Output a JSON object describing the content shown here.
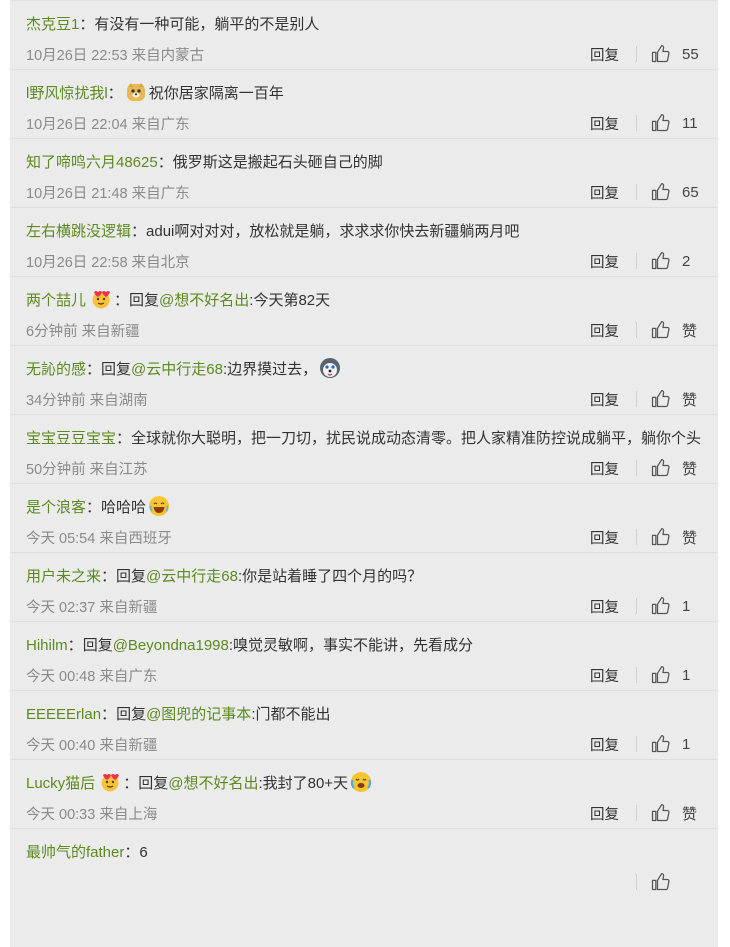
{
  "comments": [
    {
      "user": "杰克豆1",
      "sep": "：",
      "reply_prefix": "",
      "mention": "",
      "text": "有没有一种可能，躺平的不是别人",
      "emoji_before": "",
      "emoji_after": "",
      "time": "10月26日 22:53",
      "loc": "来自内蒙古",
      "reply": "回复",
      "likes": "55"
    },
    {
      "user": "l野风惊扰我l",
      "sep": "：",
      "reply_prefix": "",
      "mention": "",
      "text": "祝你居家隔离一百年",
      "emoji_before": "doge-emoji",
      "emoji_after": "",
      "time": "10月26日 22:04",
      "loc": "来自广东",
      "reply": "回复",
      "likes": "11"
    },
    {
      "user": "知了啼鸣六月48625",
      "sep": "：",
      "reply_prefix": "",
      "mention": "",
      "text": "俄罗斯这是搬起石头砸自己的脚",
      "emoji_before": "",
      "emoji_after": "",
      "time": "10月26日 21:48",
      "loc": "来自广东",
      "reply": "回复",
      "likes": "65"
    },
    {
      "user": "左右横跳没逻辑",
      "sep": "：",
      "reply_prefix": "",
      "mention": "",
      "text": "adui啊对对对，放松就是躺，求求求你快去新疆躺两月吧",
      "emoji_before": "",
      "emoji_after": "",
      "time": "10月26日 22:58",
      "loc": "来自北京",
      "reply": "回复",
      "likes": "2"
    },
    {
      "user": "两个喆儿",
      "sep": "：",
      "reply_prefix": "回复",
      "mention": "@想不好名出",
      "text": ":今天第82天",
      "emoji_before": "",
      "emoji_after": "",
      "user_badge": "heart-badge-emoji",
      "time": "6分钟前",
      "loc": "来自新疆",
      "reply": "回复",
      "likes": "赞"
    },
    {
      "user": "无訫的感",
      "sep": "：",
      "reply_prefix": "回复",
      "mention": "@云中行走68",
      "text": ":边界摸过去，",
      "emoji_before": "",
      "emoji_after": "husky-emoji",
      "time": "34分钟前",
      "loc": "来自湖南",
      "reply": "回复",
      "likes": "赞"
    },
    {
      "user": "宝宝豆豆宝宝",
      "sep": "：",
      "reply_prefix": "",
      "mention": "",
      "text": "全球就你大聪明，把一刀切，扰民说成动态清零。把人家精准防控说成躺平，躺你个头",
      "emoji_before": "",
      "emoji_after": "",
      "time": "50分钟前",
      "loc": "来自江苏",
      "reply": "回复",
      "likes": "赞"
    },
    {
      "user": "是个浪客",
      "sep": "：",
      "reply_prefix": "",
      "mention": "",
      "text": "哈哈哈",
      "emoji_before": "",
      "emoji_after": "laugh-emoji",
      "time": "今天 05:54",
      "loc": "来自西班牙",
      "reply": "回复",
      "likes": "赞"
    },
    {
      "user": "用户未之来",
      "sep": "：",
      "reply_prefix": "回复",
      "mention": "@云中行走68",
      "text": ":你是站着睡了四个月的吗？",
      "emoji_before": "",
      "emoji_after": "",
      "time": "今天 02:37",
      "loc": "来自新疆",
      "reply": "回复",
      "likes": "1"
    },
    {
      "user": "Hihilm",
      "sep": "：",
      "reply_prefix": "回复",
      "mention": "@Beyondna1998",
      "text": ":嗅觉灵敏啊，事实不能讲，先看成分",
      "emoji_before": "",
      "emoji_after": "",
      "time": "今天 00:48",
      "loc": "来自广东",
      "reply": "回复",
      "likes": "1"
    },
    {
      "user": "EEEEErlan",
      "sep": "：",
      "reply_prefix": "回复",
      "mention": "@图兜的记事本",
      "text": ":门都不能出",
      "emoji_before": "",
      "emoji_after": "",
      "time": "今天 00:40",
      "loc": "来自新疆",
      "reply": "回复",
      "likes": "1"
    },
    {
      "user": "Lucky猫后",
      "sep": "：",
      "reply_prefix": "回复",
      "mention": "@想不好名出",
      "text": ":我封了80+天",
      "emoji_before": "",
      "emoji_after": "cry-laugh-emoji",
      "user_badge": "heart-badge-emoji",
      "time": "今天 00:33",
      "loc": "来自上海",
      "reply": "回复",
      "likes": "赞"
    },
    {
      "user": "最帅气的father",
      "sep": "：",
      "reply_prefix": "",
      "mention": "",
      "text": "6",
      "emoji_before": "",
      "emoji_after": "",
      "time": "",
      "loc": "",
      "reply": "",
      "likes": ""
    }
  ],
  "colors": {
    "username": "#5c8a1f",
    "background": "#ebebeb",
    "meta": "#8a8a8a"
  }
}
